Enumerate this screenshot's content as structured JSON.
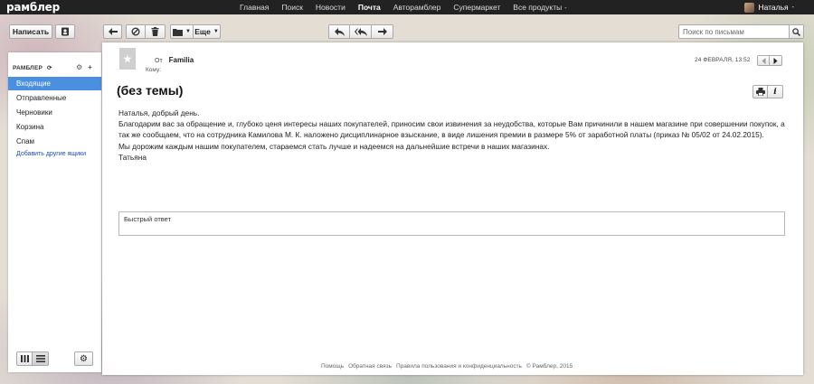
{
  "app": {
    "logo": "рамблер"
  },
  "topnav": {
    "items": [
      "Главная",
      "Поиск",
      "Новости",
      "Почта",
      "Авторамблер",
      "Супермаркет",
      "Все продукты"
    ],
    "active_index": 3,
    "more_caret": "-"
  },
  "user": {
    "name": "Наталья",
    "caret": "-"
  },
  "toolbar": {
    "compose_label": "Написать",
    "more_label": "Еще",
    "search_placeholder": "Поиск по письмам"
  },
  "sidebar": {
    "header": "РАМБЛЕР",
    "items": [
      {
        "label": "Входящие",
        "active": true
      },
      {
        "label": "Отправленные",
        "active": false
      },
      {
        "label": "Черновики",
        "active": false
      },
      {
        "label": "Корзина",
        "active": false
      },
      {
        "label": "Спам",
        "active": false
      }
    ],
    "add_link": "Добавить другие ящики"
  },
  "message": {
    "from_label": "От",
    "from_name": "Familia",
    "to_label": "Кому:",
    "date": "24 ФЕВРАЛЯ, 13:52",
    "subject": "(без темы)",
    "body": [
      "Наталья, добрый день.",
      "Благодарим вас за обращение и, глубоко ценя интересы наших покупателей, приносим свои извинения за неудобства, которые Вам причинили в нашем магазине при совершении покупок, а так же сообщаем, что на сотрудника Камилова М. К. наложено дисциплинарное взыскание, в виде лишения премии в размере 5% от заработной платы (приказ № 05/02 от 24.02.2015).",
      "Мы дорожим каждым нашим покупателем, стараемся стать лучше и надеемся на дальнейшие встречи в наших магазинах.",
      "Татьяна"
    ],
    "quick_reply_placeholder": "Быстрый ответ"
  },
  "footer": {
    "links": [
      "Помощь",
      "Обратная связь",
      "Правила пользования и конфиденциальность"
    ],
    "copyright": "© Рамблер, 2015"
  },
  "colors": {
    "topbar": "#222222",
    "active_folder": "#4a8fe0",
    "link": "#1e4bb8"
  }
}
